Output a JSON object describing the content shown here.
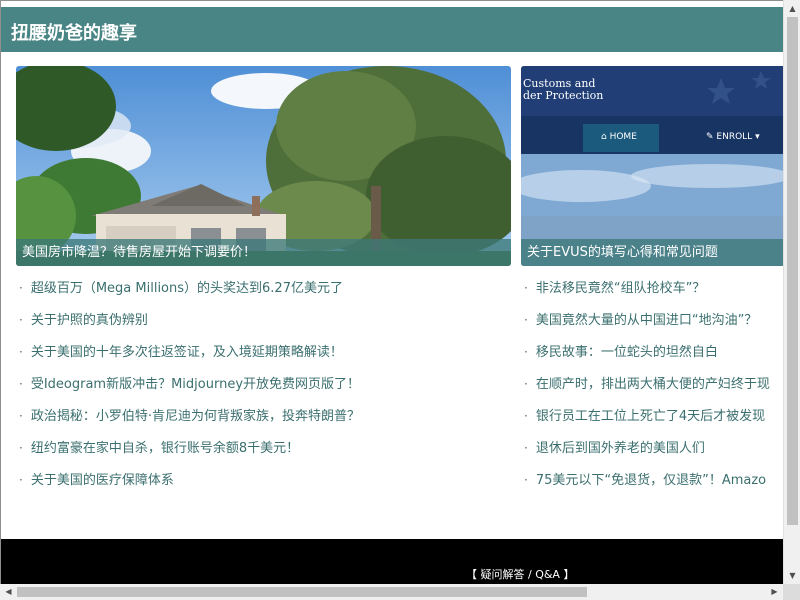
{
  "site": {
    "title": "扭腰奶爸的趣享"
  },
  "cards": [
    {
      "caption": "美国房市降温？待售房屋开始下调要价！"
    },
    {
      "caption": "关于EVUS的填写心得和常见问题",
      "banner_text": "Customs and\nder Protection",
      "nav_home": "HOME",
      "nav_enroll": "ENROLL"
    }
  ],
  "list_left": [
    "超级百万（Mega Millions）的头奖达到6.27亿美元了",
    "关于护照的真伪辨别",
    "关于美国的十年多次往返签证，及入境延期策略解读！",
    "受Ideogram新版冲击？Midjourney开放免费网页版了！",
    "政治揭秘：小罗伯特·肯尼迪为何背叛家族，投奔特朗普？",
    "纽约富豪在家中自杀，银行账号余额8千美元！",
    "关于美国的医疗保障体系"
  ],
  "list_right": [
    "非法移民竟然“组队抢校车”？",
    "美国竟然大量的从中国进口“地沟油”？",
    "移民故事：一位蛇头的坦然自白",
    "在顺产时，排出两大桶大便的产妇终于现",
    "银行员工在工位上死亡了4天后才被发现",
    "退休后到国外养老的美国人们",
    "75美元以下“免退货，仅退款”！Amazo"
  ],
  "footer": {
    "faq": "【 疑问解答 / Q&A 】"
  },
  "colors": {
    "header": "#4a8585",
    "link": "#3b6f6f",
    "footer": "#000000"
  }
}
